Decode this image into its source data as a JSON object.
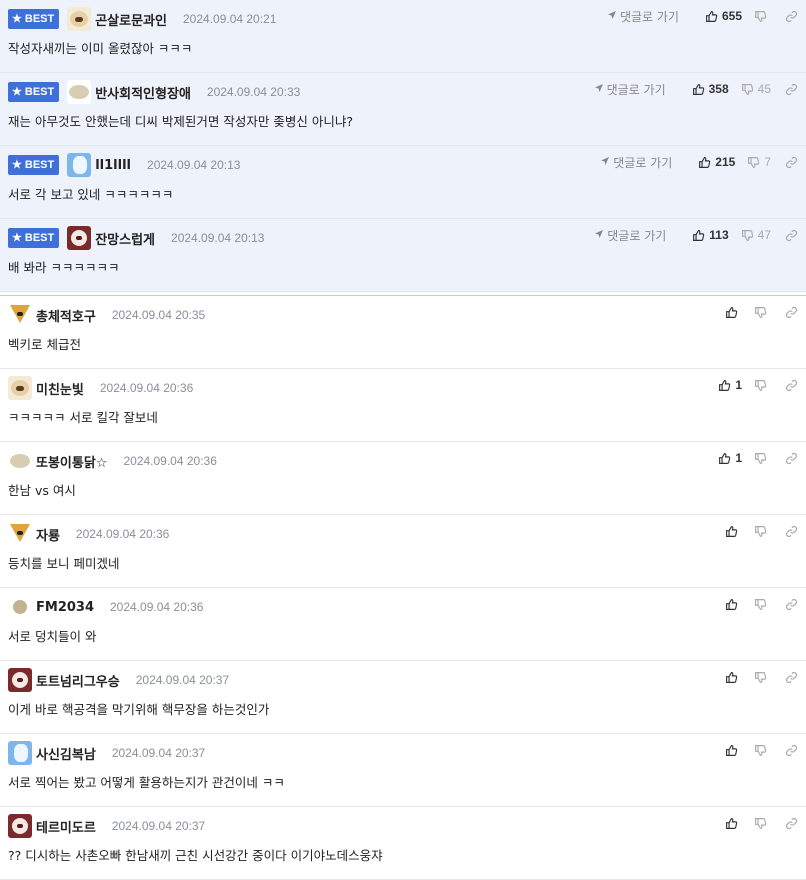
{
  "best_badge": "BEST",
  "goto_label": "댓글로 가기",
  "comments": [
    {
      "nick": "곤살로문과인",
      "date": "2024.09.04 20:21",
      "text": "작성자새끼는 이미 올렸잖아 ㅋㅋㅋ",
      "up": "655",
      "down": "",
      "best": true,
      "avatar": "dog"
    },
    {
      "nick": "반사회적인형장애",
      "date": "2024.09.04 20:33",
      "text": "재는 아무것도 안했는데 디씨 박제된거면 작성자만 좆병신 아니냐?",
      "up": "358",
      "down": "45",
      "best": true,
      "avatar": "mouse"
    },
    {
      "nick": "ll1llll",
      "date": "2024.09.04 20:13",
      "text": "서로 각 보고 있네 ㅋㅋㅋㅋㅋㅋ",
      "up": "215",
      "down": "7",
      "best": true,
      "avatar": "blue"
    },
    {
      "nick": "잔망스럽게",
      "date": "2024.09.04 20:13",
      "text": "배 봐라 ㅋㅋㅋㅋㅋㅋ",
      "up": "113",
      "down": "47",
      "best": true,
      "avatar": "red"
    },
    {
      "nick": "총체적호구",
      "date": "2024.09.04 20:35",
      "text": "벡키로 체급전",
      "up": "",
      "down": "",
      "best": false,
      "avatar": "fox"
    },
    {
      "nick": "미친눈빛",
      "date": "2024.09.04 20:36",
      "text": "ㅋㅋㅋㅋㅋ 서로 킬각 잘보네",
      "up": "1",
      "down": "",
      "best": false,
      "avatar": "dog"
    },
    {
      "nick": "또봉이통닭☆",
      "date": "2024.09.04 20:36",
      "text": "한남 vs 여시",
      "up": "1",
      "down": "",
      "best": false,
      "avatar": "mouse"
    },
    {
      "nick": "자룡",
      "date": "2024.09.04 20:36",
      "text": "등치를 보니 페미겠네",
      "up": "",
      "down": "",
      "best": false,
      "avatar": "fox"
    },
    {
      "nick": "FM2034",
      "date": "2024.09.04 20:36",
      "text": "서로 덩치들이 와",
      "up": "",
      "down": "",
      "best": false,
      "avatar": "dot"
    },
    {
      "nick": "토트넘리그우승",
      "date": "2024.09.04 20:37",
      "text": "이게 바로 핵공격을 막기위해 핵무장을 하는것인가",
      "up": "",
      "down": "",
      "best": false,
      "avatar": "red"
    },
    {
      "nick": "사신김복남",
      "date": "2024.09.04 20:37",
      "text": "서로 찍어는 봤고 어떻게 활용하는지가 관건이네 ㅋㅋ",
      "up": "",
      "down": "",
      "best": false,
      "avatar": "blue"
    },
    {
      "nick": "테르미도르",
      "date": "2024.09.04 20:37",
      "text": "?? 디시하는 사촌오빠 한남새끼 근친 시선강간 중이다 이기야노데스웅쟈",
      "up": "",
      "down": "",
      "best": false,
      "avatar": "red"
    }
  ]
}
